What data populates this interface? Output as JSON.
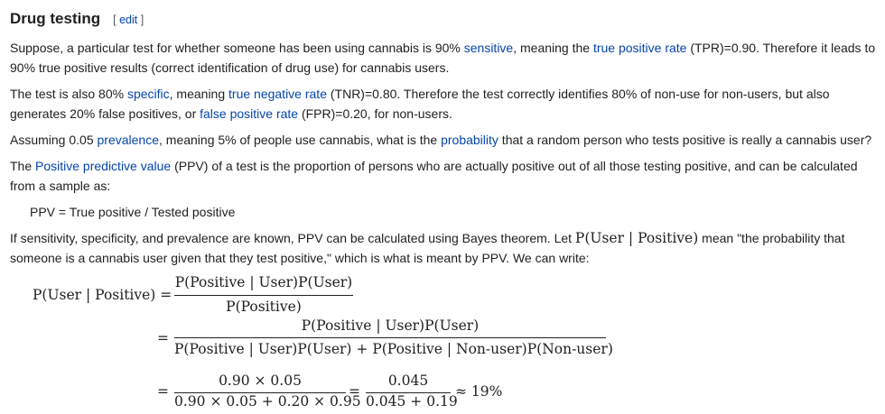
{
  "section": {
    "title": "Drug testing",
    "edit_open": "[ ",
    "edit_label": "edit",
    "edit_close": " ]"
  },
  "p1": {
    "t1": "Suppose, a particular test for whether someone has been using cannabis is 90% ",
    "l1": "sensitive",
    "t2": ", meaning the ",
    "l2": "true positive rate",
    "t3": " (TPR)=0.90. Therefore it leads to 90% true positive results (correct identification of drug use) for cannabis users."
  },
  "p2": {
    "t1": "The test is also 80% ",
    "l1": "specific",
    "t2": ", meaning ",
    "l2": "true negative rate",
    "t3": " (TNR)=0.80. Therefore the test correctly identifies 80% of non-use for non-users, but also generates 20% false positives, or ",
    "l3": "false positive rate",
    "t4": " (FPR)=0.20, for non-users."
  },
  "p3": {
    "t1": "Assuming 0.05 ",
    "l1": "prevalence",
    "t2": ", meaning 5% of people use cannabis, what is the ",
    "l2": "probability",
    "t3": " that a random person who tests positive is really a cannabis user?"
  },
  "p4": {
    "t1": "The ",
    "l1": "Positive predictive value",
    "t2": " (PPV) of a test is the proportion of persons who are actually positive out of all those testing positive, and can be calculated from a sample as:"
  },
  "ppv_formula": "PPV = True positive / Tested positive",
  "p5": {
    "t1": "If sensitivity, specificity, and prevalence are known, PPV can be calculated using Bayes theorem. Let ",
    "math": "P(User | Positive)",
    "t2": " mean \"the probability that someone is a cannabis user given that they test positive,\" which is what is meant by PPV. We can write:"
  },
  "equation": {
    "lhs": "P(User | Positive) =",
    "num1": "P(Positive | User)P(User)",
    "den1": "P(Positive)",
    "eq2": "=",
    "num2": "P(Positive | User)P(User)",
    "den2": "P(Positive | User)P(User) + P(Positive | Non-user)P(Non-user)",
    "eq3": "=",
    "num3": "0.90 × 0.05",
    "den3": "0.90 × 0.05 + 0.20 × 0.95",
    "eq4": "=",
    "num4": "0.045",
    "den4": "0.045 + 0.19",
    "result": "≈ 19%"
  }
}
